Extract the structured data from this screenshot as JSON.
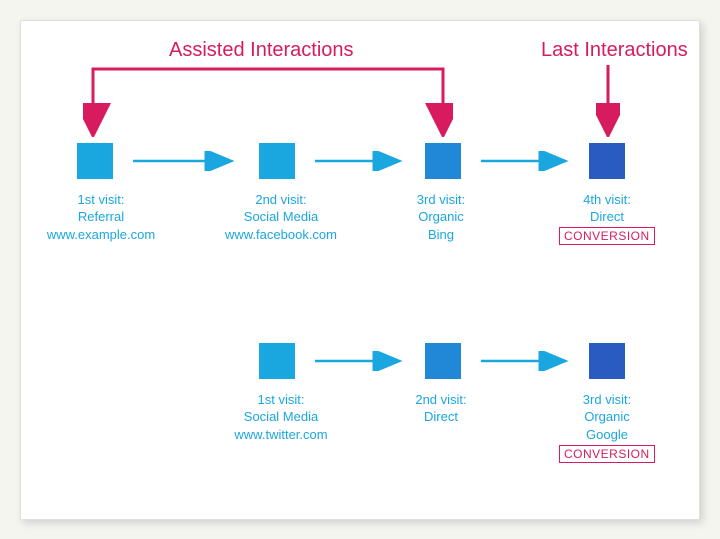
{
  "headers": {
    "assisted": "Assisted Interactions",
    "last": "Last Interactions"
  },
  "row1": {
    "v1": {
      "line1": "1st visit:",
      "line2": "Referral",
      "line3": "www.example.com"
    },
    "v2": {
      "line1": "2nd visit:",
      "line2": "Social Media",
      "line3": "www.facebook.com"
    },
    "v3": {
      "line1": "3rd visit:",
      "line2": "Organic",
      "line3": "Bing"
    },
    "v4": {
      "line1": "4th visit:",
      "line2": "Direct"
    },
    "conversion": "CONVERSION"
  },
  "row2": {
    "v1": {
      "line1": "1st visit:",
      "line2": "Social Media",
      "line3": "www.twitter.com"
    },
    "v2": {
      "line1": "2nd visit:",
      "line2": "Direct"
    },
    "v3": {
      "line1": "3rd visit:",
      "line2": "Organic",
      "line3": "Google"
    },
    "conversion": "CONVERSION"
  },
  "colors": {
    "box1": "#1aa7e0",
    "box2": "#1aa7e0",
    "box3": "#2088d6",
    "box4": "#2a5cc0",
    "arrowBlue": "#1aa7e0",
    "red": "#d81b5e"
  }
}
